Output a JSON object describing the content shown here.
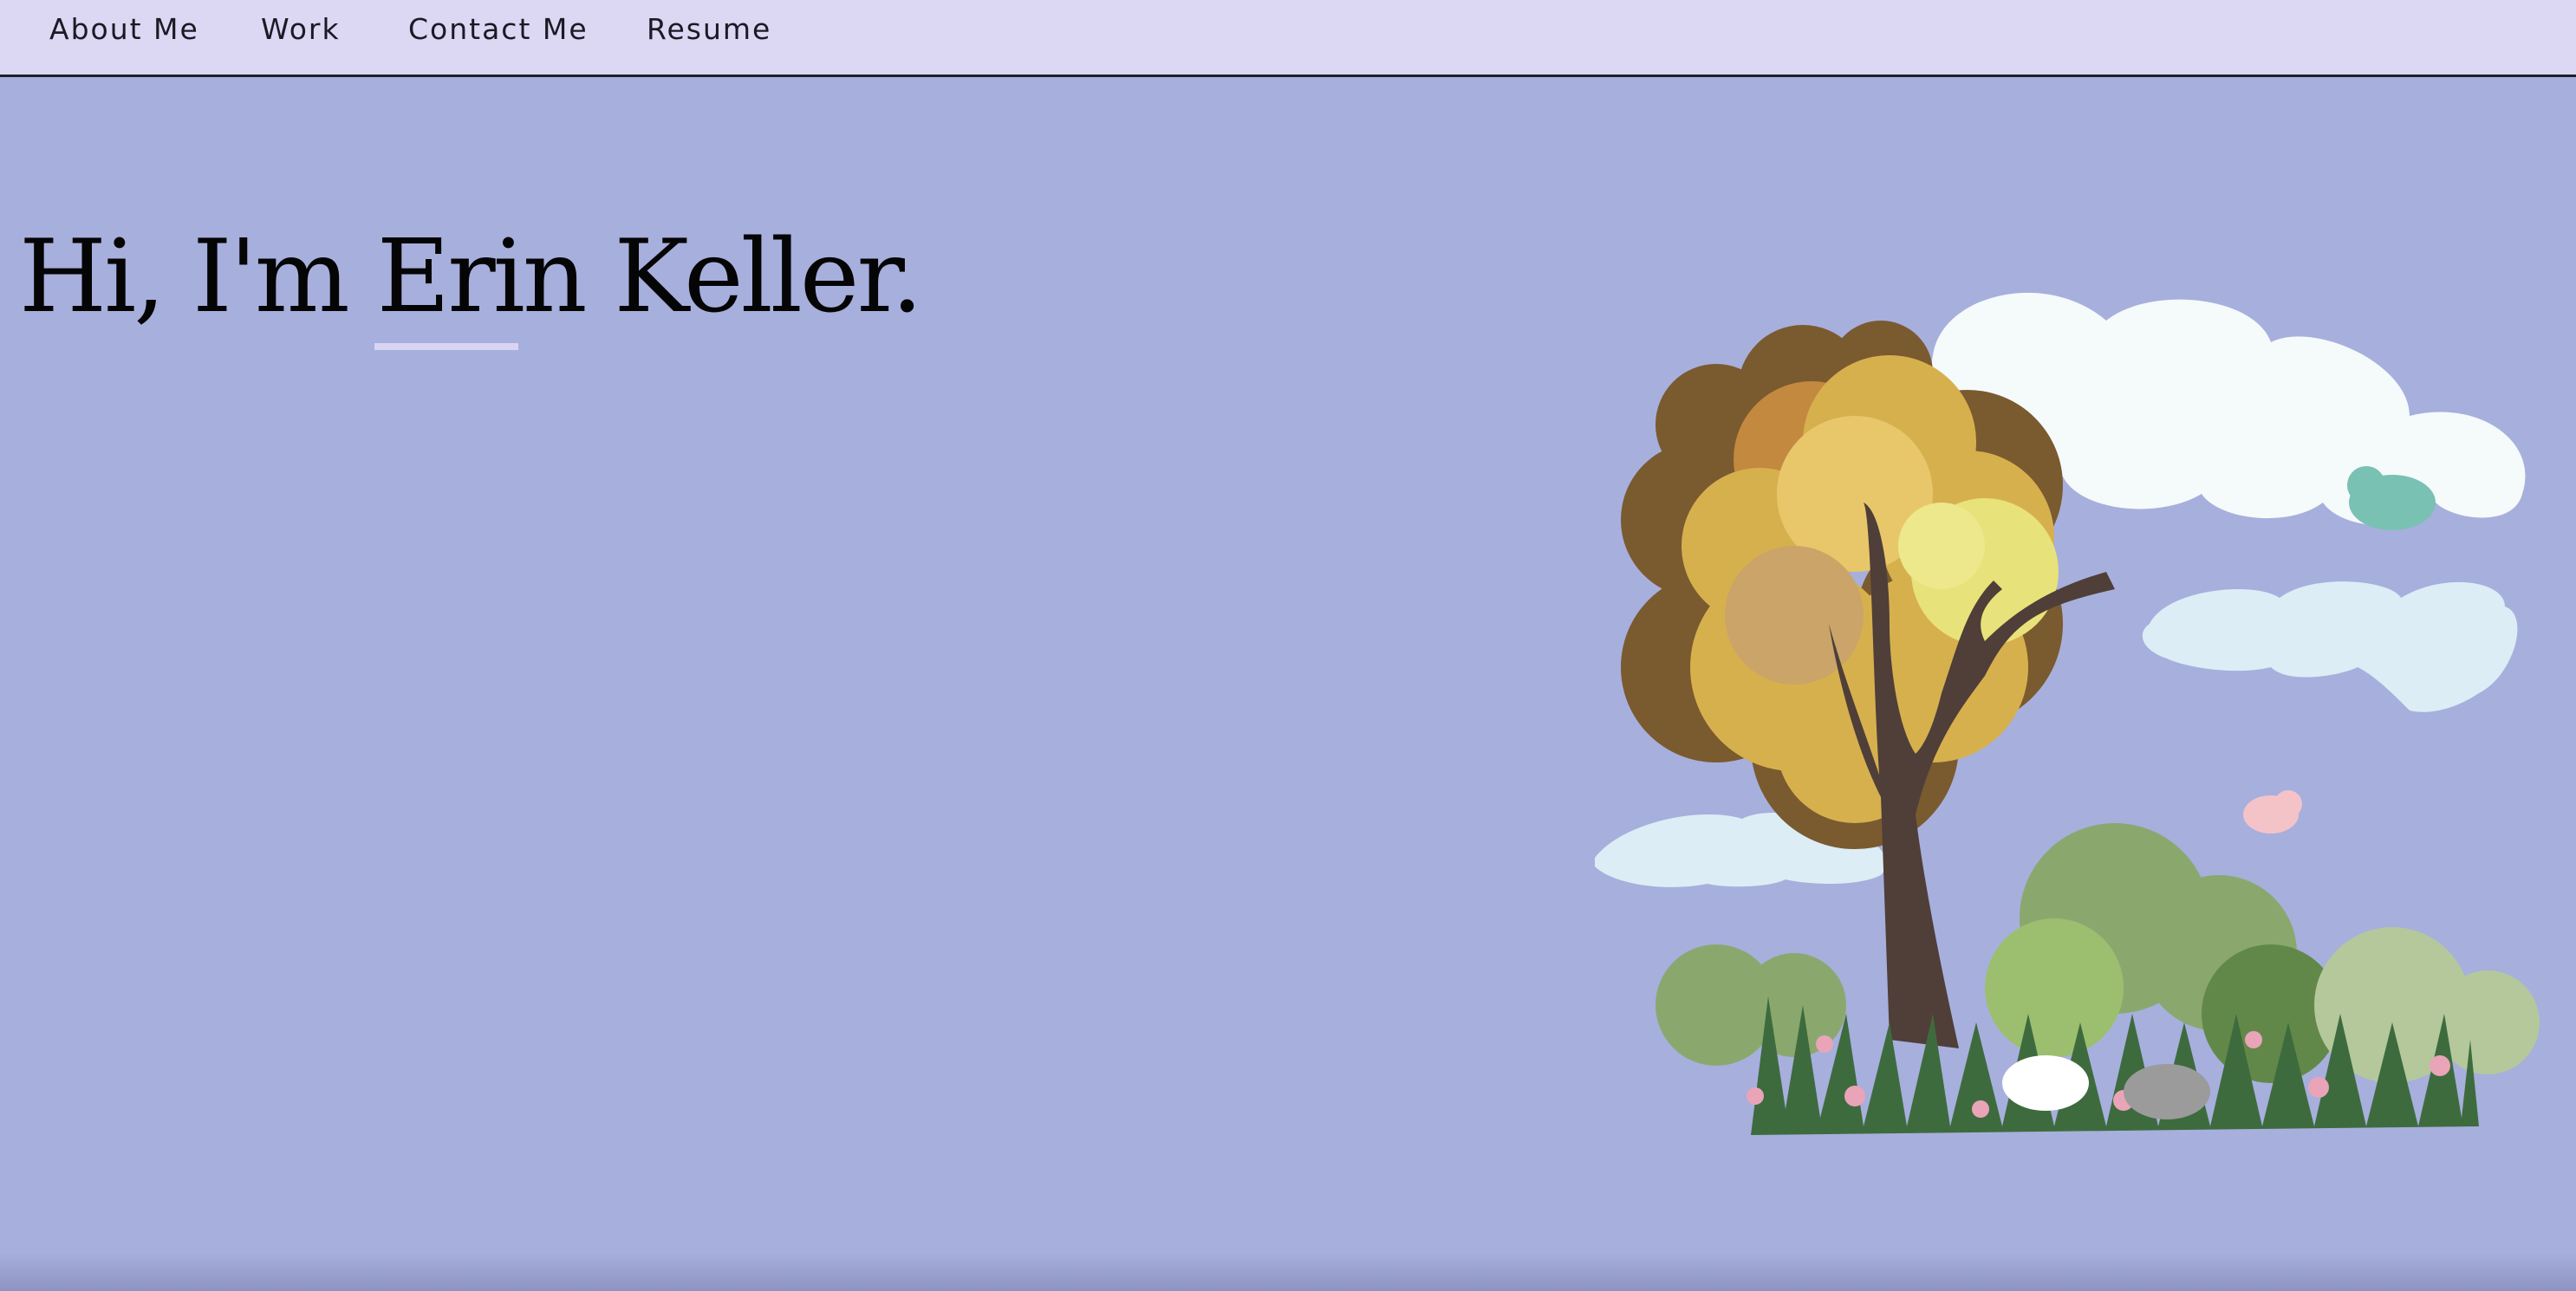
{
  "nav": {
    "items": [
      {
        "label": "About Me"
      },
      {
        "label": "Work"
      },
      {
        "label": "Contact Me"
      },
      {
        "label": "Resume"
      }
    ]
  },
  "hero": {
    "title": "Hi, I'm Erin Keller."
  },
  "colors": {
    "background": "#a7afdd",
    "navbar": "#dcd7f3",
    "underline": "#d9d4f2"
  },
  "illustration": {
    "icons": [
      "tree-icon",
      "cloud-icon",
      "bird-icon",
      "bunny-icon",
      "flower-icon",
      "bush-icon"
    ]
  }
}
